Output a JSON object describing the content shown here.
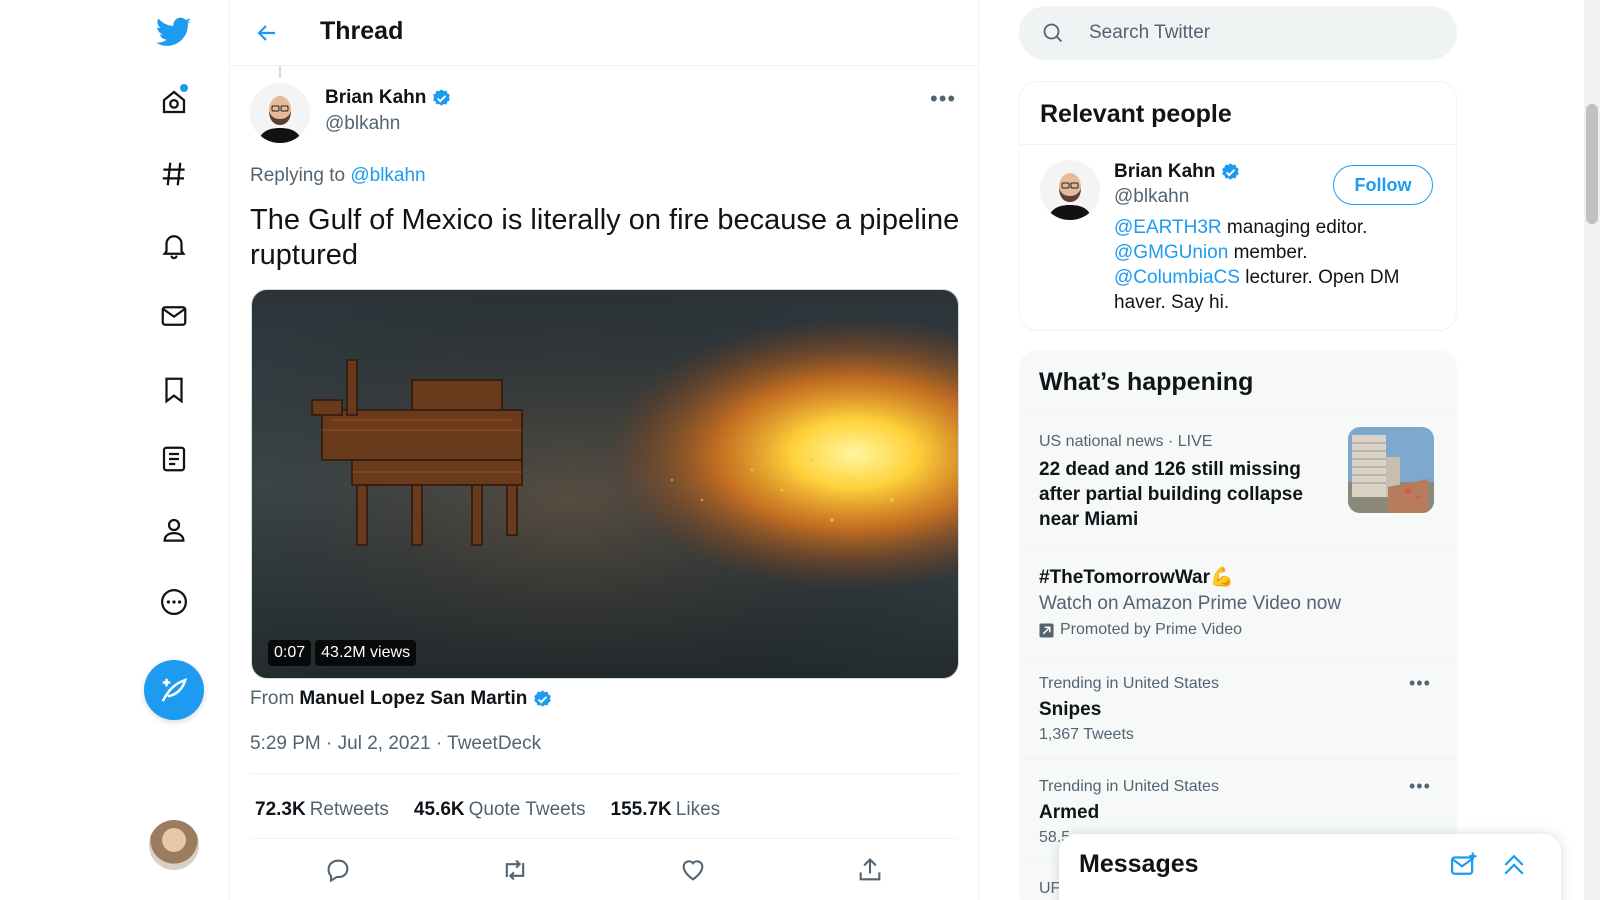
{
  "header": {
    "title": "Thread"
  },
  "tweet": {
    "author_name": "Brian Kahn",
    "author_handle": "@blkahn",
    "replying_prefix": "Replying to ",
    "replying_to": "@blkahn",
    "text": "The Gulf of Mexico is literally on fire because a pipeline ruptured",
    "video_duration": "0:07",
    "video_views": "43.2M views",
    "from_prefix": "From",
    "from_name": "Manuel Lopez San Martin",
    "meta": "5:29 PM · Jul 2, 2021 · TweetDeck",
    "stats": {
      "retweets_value": "72.3K",
      "retweets_label": "Retweets",
      "quotes_value": "45.6K",
      "quotes_label": "Quote Tweets",
      "likes_value": "155.7K",
      "likes_label": "Likes"
    }
  },
  "search": {
    "placeholder": "Search Twitter"
  },
  "relevant_people": {
    "title": "Relevant people",
    "name": "Brian Kahn",
    "handle": "@blkahn",
    "follow_label": "Follow",
    "bio": {
      "m1": "@EARTH3R",
      "t1": " managing editor.",
      "m2": "@GMGUnion",
      "t2": " member.",
      "m3": "@ColumbiaCS",
      "t3": " lecturer. Open DM haver. Say hi."
    }
  },
  "happening": {
    "title": "What’s happening",
    "news": {
      "meta": "US national news · LIVE",
      "title": "22 dead and 126 still missing after partial building collapse near Miami"
    },
    "promo": {
      "title": "#TheTomorrowWar💪",
      "sub": "Watch on Amazon Prime Video now",
      "promoted": "Promoted by Prime Video"
    },
    "trends": [
      {
        "meta": "Trending in United States",
        "title": "Snipes",
        "count": "1,367 Tweets"
      },
      {
        "meta": "Trending in United States",
        "title": "Armed",
        "count": "58.5"
      }
    ],
    "cut_off": "UF"
  },
  "messages": {
    "title": "Messages"
  },
  "colors": {
    "accent": "#1d9bf0",
    "text": "#0f1419",
    "secondary": "#536471"
  }
}
